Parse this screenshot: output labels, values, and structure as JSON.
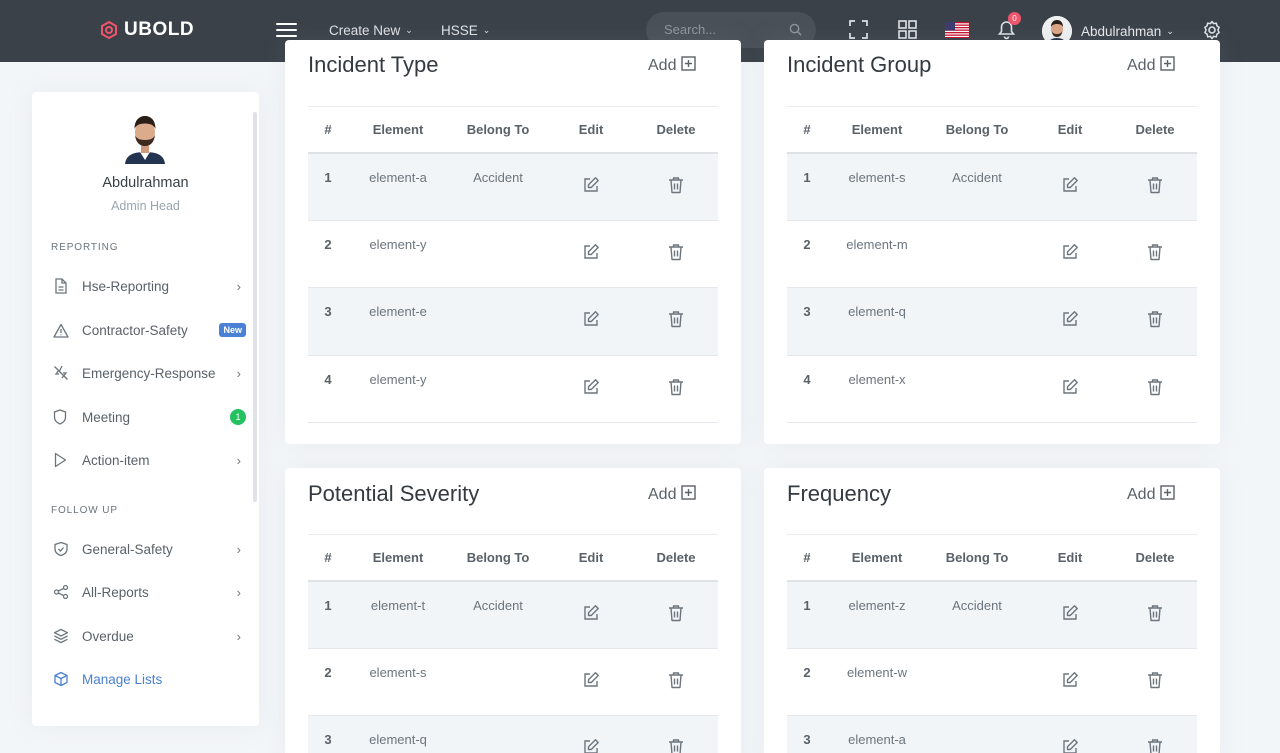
{
  "topbar": {
    "brand": "UBOLD",
    "menus": [
      {
        "label": "Create New"
      },
      {
        "label": "HSSE"
      }
    ],
    "search_placeholder": "Search...",
    "notification_count": "0",
    "user_name": "Abdulrahman"
  },
  "sidebar": {
    "user_name": "Abdulrahman",
    "user_role": "Admin Head",
    "sections": [
      {
        "title": "REPORTING"
      },
      {
        "title": "FOLLOW UP"
      }
    ],
    "items": [
      {
        "label": "Hse-Reporting",
        "icon": "document-icon"
      },
      {
        "label": "Contractor-Safety",
        "icon": "warning-icon",
        "badge": "New"
      },
      {
        "label": "Emergency-Response",
        "icon": "zap-off-icon"
      },
      {
        "label": "Meeting",
        "icon": "shield-icon",
        "badge": "1"
      },
      {
        "label": "Action-item",
        "icon": "play-icon"
      },
      {
        "label": "General-Safety",
        "icon": "shield-check-icon"
      },
      {
        "label": "All-Reports",
        "icon": "share-icon"
      },
      {
        "label": "Overdue",
        "icon": "layers-icon"
      },
      {
        "label": "Manage Lists",
        "icon": "package-icon"
      }
    ]
  },
  "headers": {
    "num": "#",
    "element": "Element",
    "belong": "Belong To",
    "edit": "Edit",
    "delete": "Delete"
  },
  "add_label": "Add",
  "cards": [
    {
      "title": "Incident Type",
      "rows": [
        {
          "num": "1",
          "element": "element-a",
          "belong": "Accident"
        },
        {
          "num": "2",
          "element": "element-y",
          "belong": ""
        },
        {
          "num": "3",
          "element": "element-e",
          "belong": ""
        },
        {
          "num": "4",
          "element": "element-y",
          "belong": ""
        }
      ]
    },
    {
      "title": "Incident Group",
      "rows": [
        {
          "num": "1",
          "element": "element-s",
          "belong": "Accident"
        },
        {
          "num": "2",
          "element": "element-m",
          "belong": ""
        },
        {
          "num": "3",
          "element": "element-q",
          "belong": ""
        },
        {
          "num": "4",
          "element": "element-x",
          "belong": ""
        }
      ]
    },
    {
      "title": "Potential Severity",
      "rows": [
        {
          "num": "1",
          "element": "element-t",
          "belong": "Accident"
        },
        {
          "num": "2",
          "element": "element-s",
          "belong": ""
        },
        {
          "num": "3",
          "element": "element-q",
          "belong": ""
        }
      ]
    },
    {
      "title": "Frequency",
      "rows": [
        {
          "num": "1",
          "element": "element-z",
          "belong": "Accident"
        },
        {
          "num": "2",
          "element": "element-w",
          "belong": ""
        },
        {
          "num": "3",
          "element": "element-a",
          "belong": ""
        }
      ]
    }
  ],
  "colors": {
    "topbar": "#3a4149",
    "accent": "#4a81d4",
    "badge_new": "#4a81d4",
    "badge_count": "#23c160",
    "notification": "#f1556c"
  }
}
